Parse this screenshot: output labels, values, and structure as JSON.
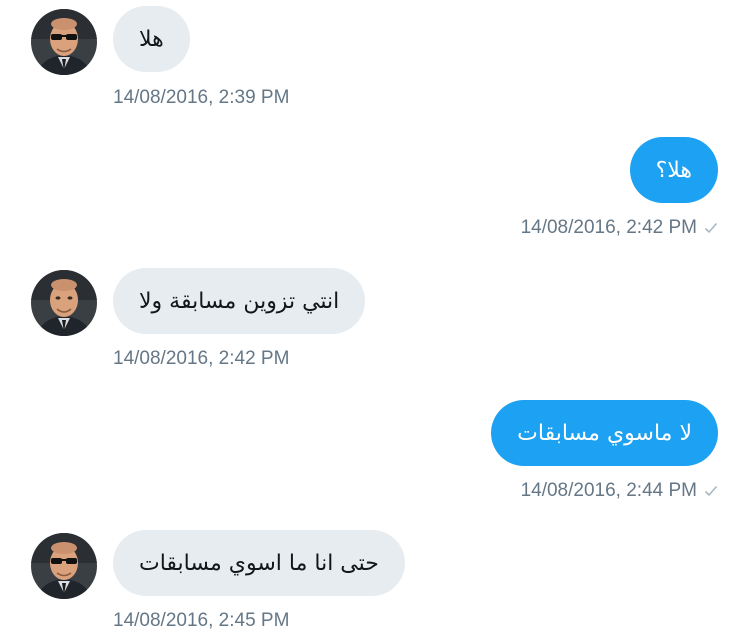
{
  "messages": [
    {
      "direction": "incoming",
      "text": "هلا",
      "timestamp": "14/08/2016, 2:39 PM"
    },
    {
      "direction": "outgoing",
      "text": "هلا؟",
      "timestamp": "14/08/2016, 2:42 PM",
      "status_icon": "check-icon"
    },
    {
      "direction": "incoming",
      "text": "انتي تزوين مسابقة ولا",
      "timestamp": "14/08/2016, 2:42 PM"
    },
    {
      "direction": "outgoing",
      "text": "لا ماسوي مسابقات",
      "timestamp": "14/08/2016, 2:44 PM",
      "status_icon": "check-icon"
    },
    {
      "direction": "incoming",
      "text": "حتى انا ما اسوي مسابقات",
      "timestamp": "14/08/2016, 2:45 PM"
    }
  ],
  "colors": {
    "incoming_bubble": "#e6ecf0",
    "outgoing_bubble": "#1da1f2",
    "timestamp": "#657786",
    "check": "#aab8c2"
  }
}
